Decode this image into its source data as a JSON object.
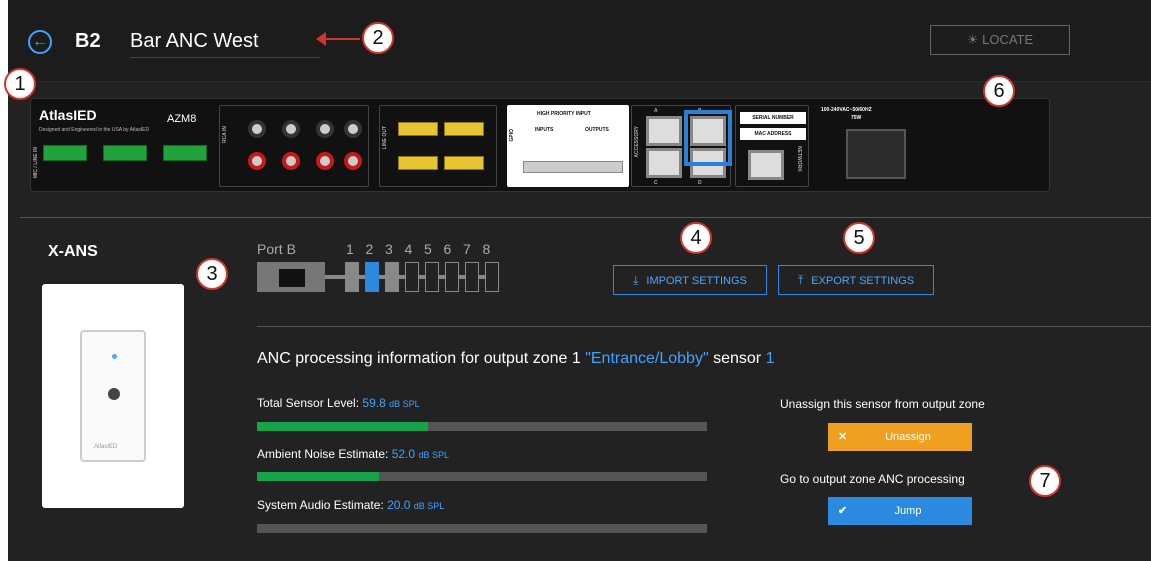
{
  "header": {
    "back_icon": "arrow-left-circle-icon",
    "zone_id": "B2",
    "zone_name": "Bar ANC West",
    "locate_label": "LOCATE",
    "locate_icon": "lightbulb-icon"
  },
  "device": {
    "brand": "AtlasIED",
    "brand_sub": "Designed and Engineered in the USA by AtlasIED",
    "model": "AZM8",
    "mic_line_in": "MIC / LINE IN",
    "rca_in": "RCA IN",
    "line_out": "LINE OUT",
    "gpio": "GPIO",
    "high_priority_input": "HIGH PRIORITY INPUT",
    "inputs": "INPUTS",
    "outputs": "OUTPUTS",
    "accessory": "ACCESSORY",
    "serial_number": "SERIAL NUMBER",
    "mac_address": "MAC ADDRESS",
    "network": "NETWORK",
    "power_spec": "100-240VAC~50/60HZ",
    "power_watts": "75W",
    "port_letters": [
      "A",
      "B",
      "C",
      "D"
    ],
    "highlighted_port": "B"
  },
  "sensor": {
    "section_title": "X-ANS",
    "logo_text": "AtlasIED"
  },
  "ports": {
    "label": "Port B",
    "numbers": [
      "1",
      "2",
      "3",
      "4",
      "5",
      "6",
      "7",
      "8"
    ],
    "active": 2
  },
  "actions": {
    "import_label": "IMPORT SETTINGS",
    "export_label": "EXPORT SETTINGS",
    "import_icon": "download-icon",
    "export_icon": "upload-icon"
  },
  "anc": {
    "title_prefix": "ANC processing information for output zone 1",
    "zone_name": "\"Entrance/Lobby\"",
    "sensor_word": "sensor",
    "sensor_number": "1",
    "meters": [
      {
        "label": "Total Sensor Level:",
        "value": "59.8",
        "unit": "dB SPL",
        "fill": 0.38
      },
      {
        "label": "Ambient Noise Estimate:",
        "value": "52.0",
        "unit": "dB SPL",
        "fill": 0.27
      },
      {
        "label": "System Audio Estimate:",
        "value": "20.0",
        "unit": "dB SPL",
        "fill": 0.0
      }
    ],
    "unassign_prompt": "Unassign this sensor from output zone",
    "unassign_label": "Unassign",
    "jump_prompt": "Go to output zone ANC processing",
    "jump_label": "Jump",
    "colors": {
      "unassign": "#f0a020",
      "jump": "#2b8ae0",
      "meter_fill": "#16a34a"
    }
  },
  "callouts": [
    "1",
    "2",
    "3",
    "4",
    "5",
    "6",
    "7"
  ]
}
